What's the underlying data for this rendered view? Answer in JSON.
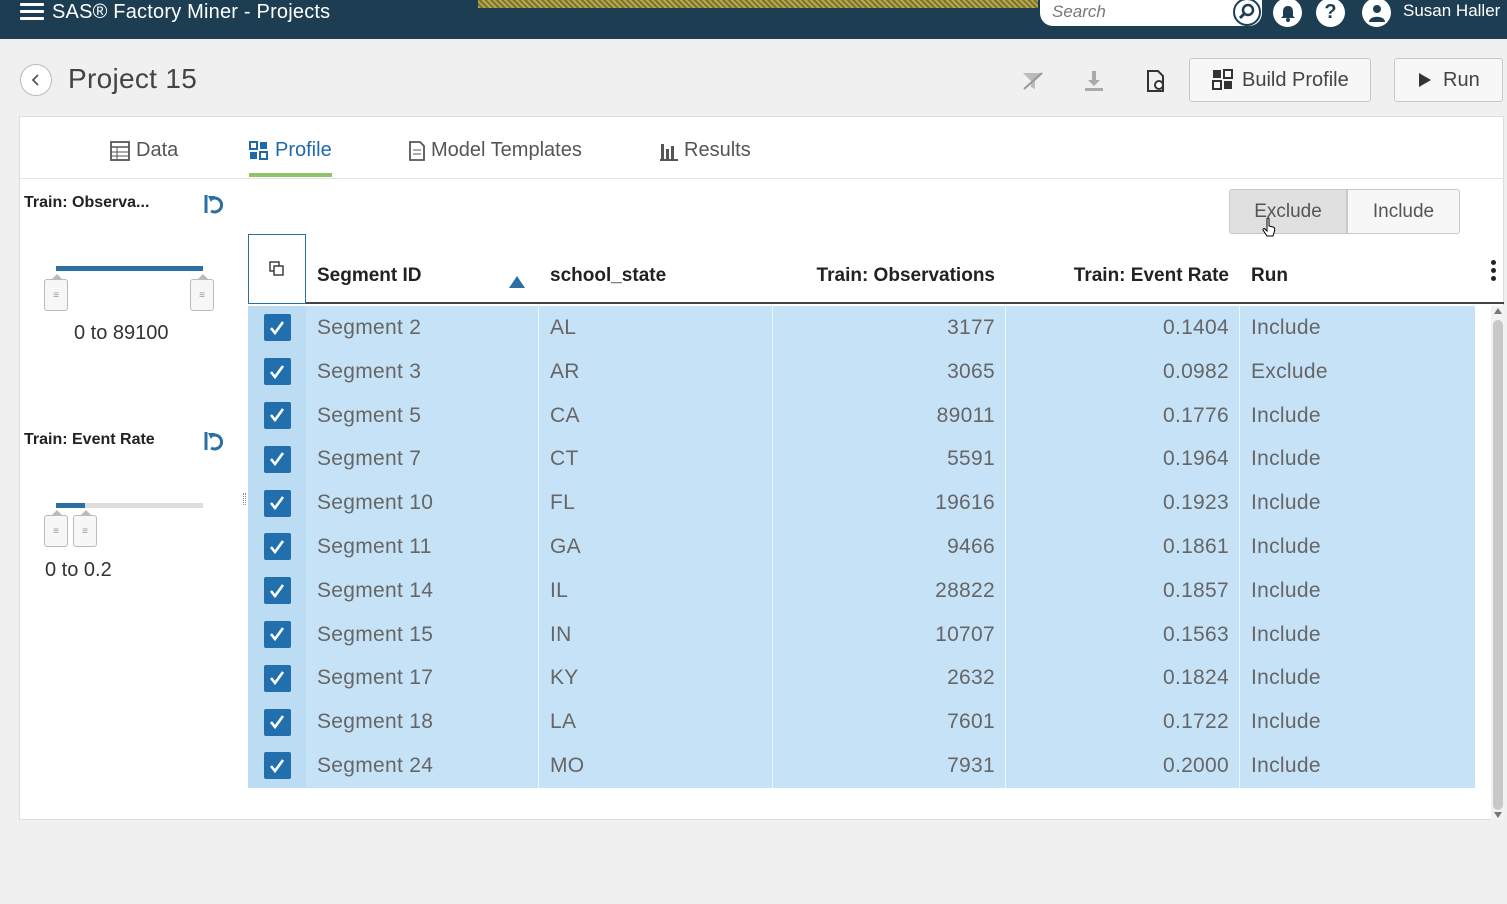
{
  "app": {
    "title": "SAS® Factory Miner - Projects",
    "search_placeholder": "Search",
    "user": "Susan Haller"
  },
  "project": {
    "title": "Project 15",
    "build_profile_label": "Build Profile",
    "run_label": "Run"
  },
  "tabs": [
    {
      "label": "Data",
      "icon": "table-icon"
    },
    {
      "label": "Profile",
      "icon": "grid-icon",
      "active": true
    },
    {
      "label": "Model Templates",
      "icon": "document-icon"
    },
    {
      "label": "Results",
      "icon": "bar-chart-icon"
    }
  ],
  "filters": {
    "observations": {
      "title": "Train: Observa...",
      "range": "0 to 89100"
    },
    "event_rate": {
      "title": "Train: Event Rate",
      "range": "0 to 0.2"
    }
  },
  "actions": {
    "exclude_label": "Exclude",
    "include_label": "Include"
  },
  "table": {
    "columns": [
      "Segment ID",
      "school_state",
      "Train: Observations",
      "Train: Event Rate",
      "Run"
    ],
    "rows": [
      {
        "segment": "Segment 2",
        "state": "AL",
        "obs": "3177",
        "rate": "0.1404",
        "run": "Include"
      },
      {
        "segment": "Segment 3",
        "state": "AR",
        "obs": "3065",
        "rate": "0.0982",
        "run": "Exclude"
      },
      {
        "segment": "Segment 5",
        "state": "CA",
        "obs": "89011",
        "rate": "0.1776",
        "run": "Include"
      },
      {
        "segment": "Segment 7",
        "state": "CT",
        "obs": "5591",
        "rate": "0.1964",
        "run": "Include"
      },
      {
        "segment": "Segment 10",
        "state": "FL",
        "obs": "19616",
        "rate": "0.1923",
        "run": "Include"
      },
      {
        "segment": "Segment 11",
        "state": "GA",
        "obs": "9466",
        "rate": "0.1861",
        "run": "Include"
      },
      {
        "segment": "Segment 14",
        "state": "IL",
        "obs": "28822",
        "rate": "0.1857",
        "run": "Include"
      },
      {
        "segment": "Segment 15",
        "state": "IN",
        "obs": "10707",
        "rate": "0.1563",
        "run": "Include"
      },
      {
        "segment": "Segment 17",
        "state": "KY",
        "obs": "2632",
        "rate": "0.1824",
        "run": "Include"
      },
      {
        "segment": "Segment 18",
        "state": "LA",
        "obs": "7601",
        "rate": "0.1722",
        "run": "Include"
      },
      {
        "segment": "Segment 24",
        "state": "MO",
        "obs": "7931",
        "rate": "0.2000",
        "run": "Include"
      }
    ]
  },
  "colors": {
    "banner": "#1d3d53",
    "accent": "#2b6fa3",
    "selected_row": "#c6e2f6",
    "tab_underline": "#8fc46a"
  }
}
